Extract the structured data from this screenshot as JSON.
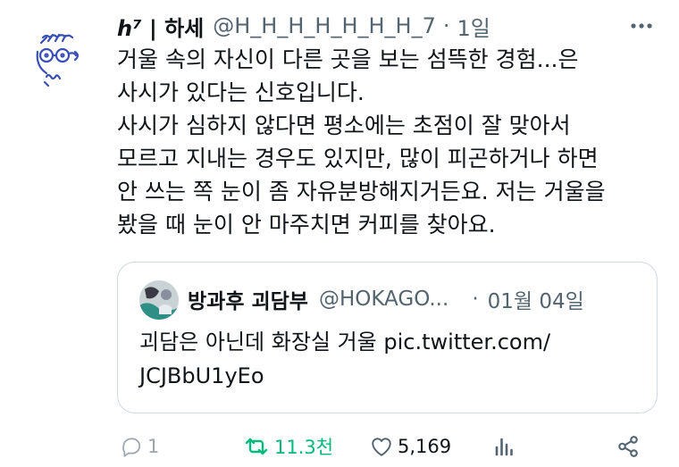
{
  "author": {
    "display_name_logo": "h⁷",
    "display_name": "| 하세",
    "handle": "@H_H_H_H_H_H_H_7",
    "separator": "·",
    "time": "1일",
    "avatar_icon": "doodle-face-icon"
  },
  "tweet": {
    "lines": [
      "거울 속의 자신이 다른 곳을 보는 섬뜩한 경험...은",
      "사시가 있다는 신호입니다.",
      "사시가 심하지 않다면 평소에는 초점이 잘 맞아서",
      "모르고 지내는 경우도 있지만, 많이 피곤하거나 하면",
      "안 쓰는 쪽 눈이 좀 자유분방해지거든요. 저는 거울을",
      "봤을 때 눈이 안 마주치면 커피를 찾아요."
    ]
  },
  "quote": {
    "display_name": "방과후 괴담부",
    "handle": "@HOKAGO...",
    "separator": "·",
    "date": "01월 04일",
    "lines": [
      "괴담은 아닌데 화장실 거울 pic.twitter.com/",
      "JCJBbU1yEo"
    ]
  },
  "actions": {
    "reply_count": "1",
    "retweet_count": "11.3천",
    "like_count": "5,169"
  },
  "colors": {
    "text": "#0f1419",
    "secondary": "#536471",
    "retweet_green": "#00ba7c",
    "border": "#cfd9de"
  }
}
